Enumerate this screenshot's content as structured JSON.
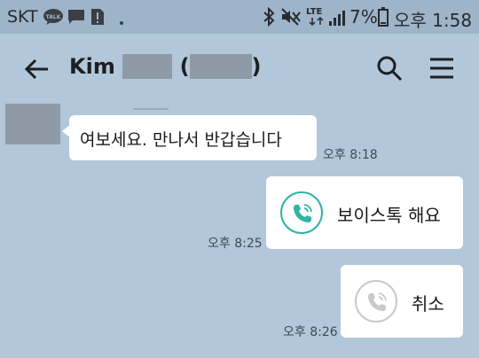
{
  "status_bar": {
    "carrier": "SKT",
    "talk_badge": "TALK",
    "network_type": "LTE",
    "battery_percent": "7%",
    "time": "오후 1:58",
    "icons": [
      "kakaotalk-icon",
      "chat-icon",
      "sim-alert-icon",
      "dot-icon",
      "bluetooth-icon",
      "mute-icon",
      "lte-icon",
      "signal-icon",
      "battery-icon"
    ]
  },
  "app_bar": {
    "title_prefix": "Kim",
    "open_paren": "(",
    "close_paren": ")",
    "icons": [
      "back-arrow-icon",
      "search-icon",
      "menu-icon"
    ]
  },
  "messages": [
    {
      "direction": "in",
      "text": "여보세요. 만나서 반갑습니다",
      "time": "오후 8:18"
    },
    {
      "direction": "out",
      "type": "voice-call",
      "text": "보이스톡 해요",
      "time": "오후 8:25",
      "icon_color": "#2fb3a5"
    },
    {
      "direction": "out",
      "type": "voice-call-cancelled",
      "text": "취소",
      "time": "오후 8:26",
      "icon_color": "#c9c9c9"
    }
  ],
  "colors": {
    "chat_background": "#b2c7d9",
    "status_bar": "#9eb4c8",
    "bubble": "#ffffff",
    "accent": "#2fb3a5"
  }
}
